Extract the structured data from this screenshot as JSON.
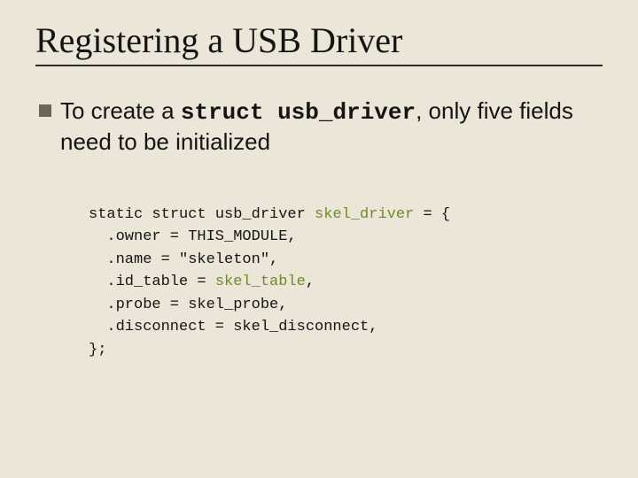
{
  "title": "Registering a USB Driver",
  "bullet": {
    "pre": "To create a ",
    "mono": "struct usb_driver",
    "post": ", only five fields need to be initialized"
  },
  "code": {
    "l1a": "static struct usb_driver ",
    "l1b": "skel_driver",
    "l1c": " = {",
    "l2": ".owner = THIS_MODULE,",
    "l3": ".name = \"skeleton\",",
    "l4a": ".id_table = ",
    "l4b": "skel_table",
    "l4c": ",",
    "l5": ".probe = skel_probe,",
    "l6": ".disconnect = skel_disconnect,",
    "l7": "};"
  }
}
